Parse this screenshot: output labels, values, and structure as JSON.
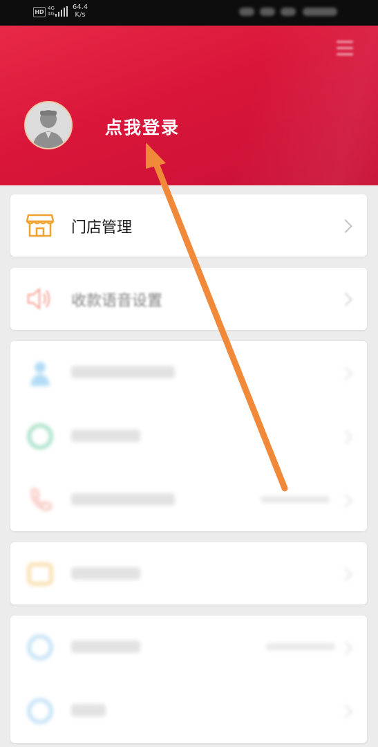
{
  "status_bar": {
    "hd": "HD",
    "network": "4G",
    "signal_sub": "4G",
    "speed_value": "64.4",
    "speed_unit": "K/s"
  },
  "header": {
    "menu_icon": "menu-icon",
    "avatar_icon": "user-avatar-icon",
    "login_text": "点我登录"
  },
  "menu": [
    {
      "id": "store",
      "label": "门店管理",
      "icon": "storefront-icon",
      "icon_color": "#f0a332",
      "visible_state": "clear"
    },
    {
      "id": "voice",
      "label": "收款语音设置",
      "icon": "speaker-icon",
      "icon_color": "#f08a7a",
      "visible_state": "slightly-blurred"
    }
  ],
  "colors": {
    "header_red": "#d9163a",
    "arrow_orange": "#f08a3a",
    "background": "#ececec"
  }
}
